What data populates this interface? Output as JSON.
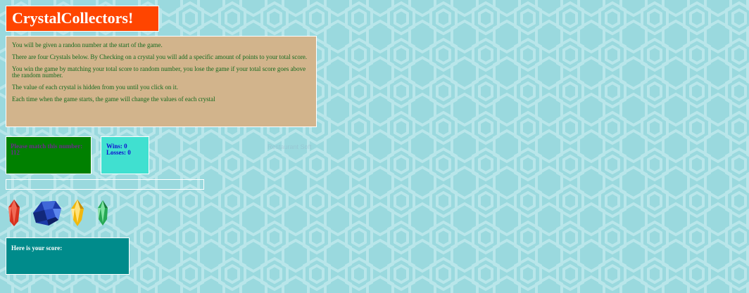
{
  "title": "CrystalCollectors!",
  "rules": [
    "You will be given a randon number at the start of the game.",
    "There are four Crystals below. By Checking on a crystal you will add a specific amount of points to your total score.",
    "You win the game by matching your total score to random number, you lose the game if your total score goes above the random number.",
    "The value of each crystal is hidden from you until you click on it.",
    "Each time when the game starts, the game will change the values of each crystal"
  ],
  "target": {
    "text": "Please match this number: 112"
  },
  "stats": {
    "wins": "Wins: 0",
    "losses": "Losses: 0"
  },
  "score": {
    "label": "Here is your score:"
  },
  "watermark": "Restaurant Soft",
  "crystals": [
    {
      "name": "red",
      "color": "#e03a2a"
    },
    {
      "name": "blue",
      "color": "#1f3fb0"
    },
    {
      "name": "yellow",
      "color": "#f5c21a"
    },
    {
      "name": "green",
      "color": "#2bb15a"
    }
  ],
  "colors": {
    "background": "#9ad9de",
    "title_bg": "#ff4500",
    "rules_bg": "#d2b48c",
    "target_bg": "#008000",
    "stats_bg": "#40e0d0",
    "score_bg": "#008b8b"
  }
}
